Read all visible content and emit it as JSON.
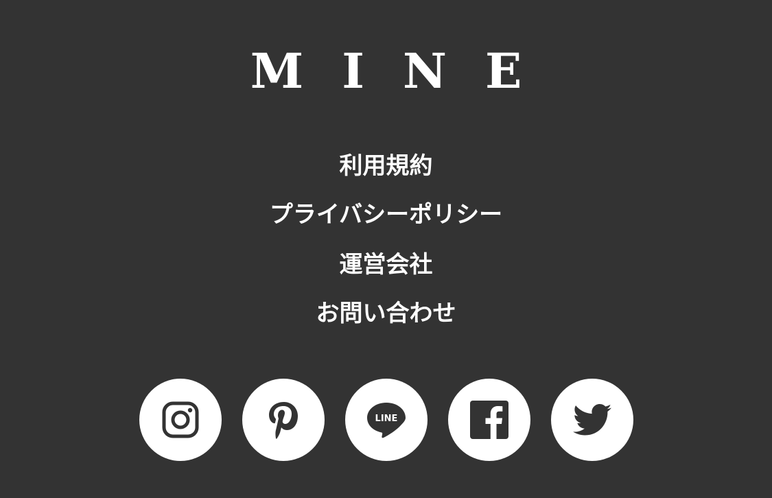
{
  "brand": {
    "letters": [
      "M",
      "I",
      "N",
      "E"
    ]
  },
  "links": [
    {
      "label": "利用規約"
    },
    {
      "label": "プライバシーポリシー"
    },
    {
      "label": "運営会社"
    },
    {
      "label": "お問い合わせ"
    }
  ],
  "social": {
    "icons": [
      "instagram-icon",
      "pinterest-icon",
      "line-icon",
      "facebook-icon",
      "twitter-icon"
    ],
    "line_label": "LINE"
  },
  "colors": {
    "background": "#333333",
    "foreground": "#ffffff"
  }
}
